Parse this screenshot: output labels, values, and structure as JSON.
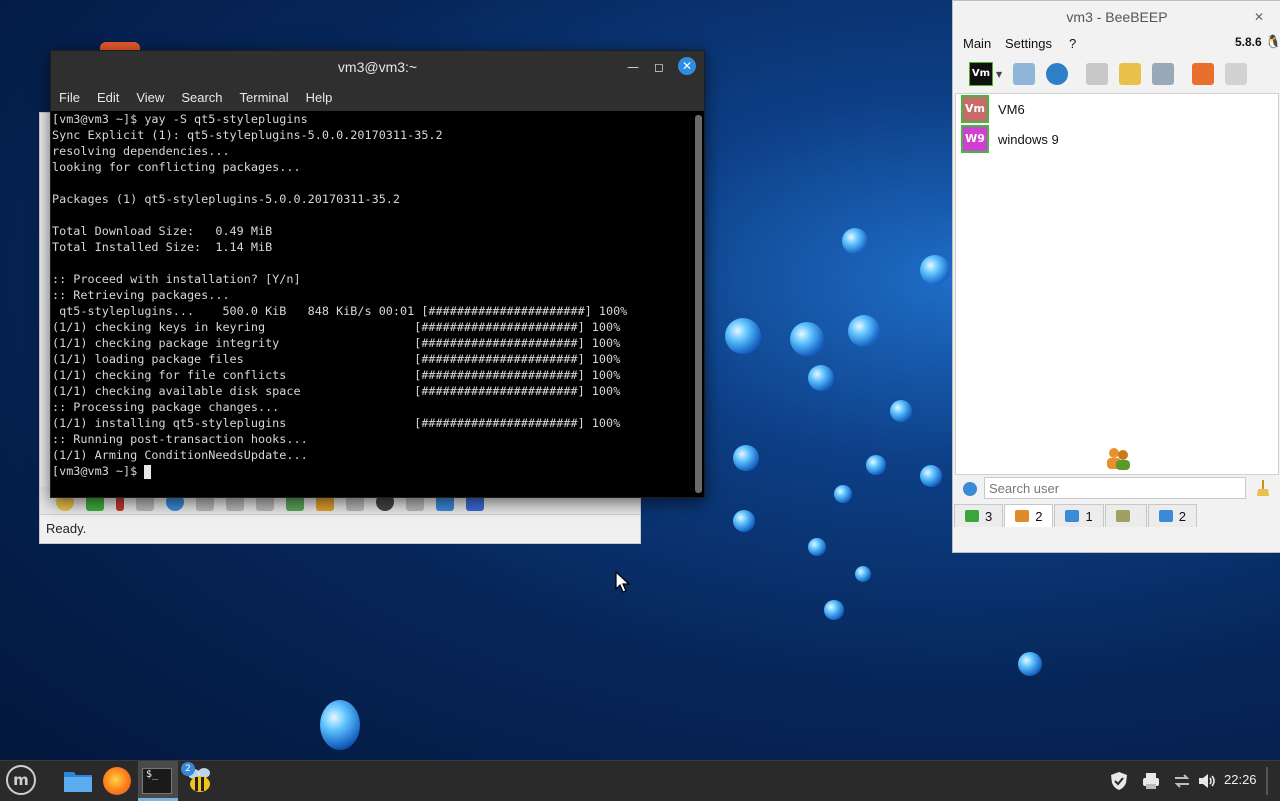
{
  "colors": {
    "accent": "#2f8de0",
    "terminal_bg": "#000000",
    "terminal_text": "#d7d7d7",
    "taskbar_bg": "#2a2a2a",
    "online_green": "#3fb93f"
  },
  "background_window": {
    "status": "Ready."
  },
  "terminal": {
    "title": "vm3@vm3:~",
    "menu": [
      "File",
      "Edit",
      "View",
      "Search",
      "Terminal",
      "Help"
    ],
    "lines": [
      "[vm3@vm3 ~]$ yay -S qt5-styleplugins",
      "Sync Explicit (1): qt5-styleplugins-5.0.0.20170311-35.2",
      "resolving dependencies...",
      "looking for conflicting packages...",
      "",
      "Packages (1) qt5-styleplugins-5.0.0.20170311-35.2",
      "",
      "Total Download Size:   0.49 MiB",
      "Total Installed Size:  1.14 MiB",
      "",
      ":: Proceed with installation? [Y/n]",
      ":: Retrieving packages...",
      " qt5-styleplugins...    500.0 KiB   848 KiB/s 00:01 [######################] 100%",
      "(1/1) checking keys in keyring                     [######################] 100%",
      "(1/1) checking package integrity                   [######################] 100%",
      "(1/1) loading package files                        [######################] 100%",
      "(1/1) checking for file conflicts                  [######################] 100%",
      "(1/1) checking available disk space                [######################] 100%",
      ":: Processing package changes...",
      "(1/1) installing qt5-styleplugins                  [######################] 100%",
      ":: Running post-transaction hooks...",
      "(1/1) Arming ConditionNeedsUpdate..."
    ],
    "prompt": "[vm3@vm3 ~]$ "
  },
  "beebeep": {
    "title": "vm3 - BeeBEEP",
    "menu": [
      "Main",
      "Settings",
      "?"
    ],
    "version": "5.8.6",
    "vm_icon_label": "Vm",
    "users": [
      {
        "avatar": "Vm",
        "name": "VM6",
        "avatar_color": "#c86a6a"
      },
      {
        "avatar": "W9",
        "name": "windows 9",
        "avatar_color": "#d13fd1"
      }
    ],
    "search_placeholder": "Search user",
    "tabs": [
      {
        "label": "3",
        "icon": "users-online-icon",
        "color": "#3aa53a"
      },
      {
        "label": "2",
        "icon": "groups-icon",
        "color": "#e08a2a"
      },
      {
        "label": "1",
        "icon": "chats-icon",
        "color": "#3a8ad8"
      },
      {
        "label": "",
        "icon": "network-icon",
        "color": "#a0a060"
      },
      {
        "label": "2",
        "icon": "files-icon",
        "color": "#3a8ad8"
      }
    ]
  },
  "taskbar": {
    "clock": "22:26",
    "terminal_glyph": "$_",
    "beebeep_badge": "2"
  }
}
